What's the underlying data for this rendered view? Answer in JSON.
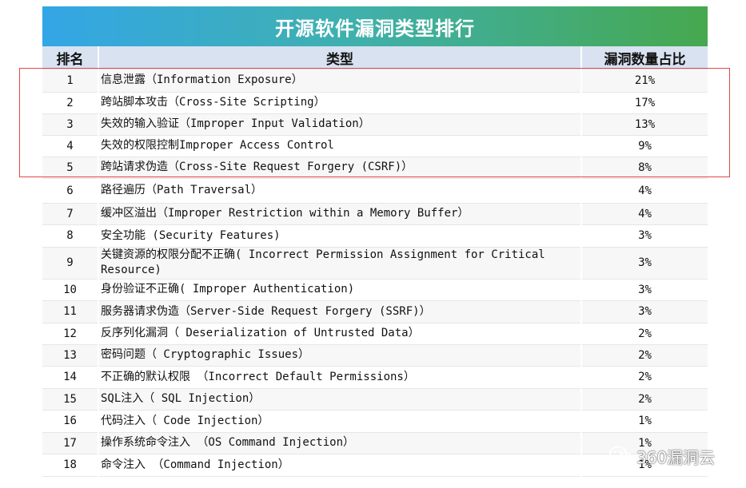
{
  "title": "开源软件漏洞类型排行",
  "headers": {
    "rank": "排名",
    "type": "类型",
    "share": "漏洞数量占比"
  },
  "rows": [
    {
      "rank": "1",
      "type": "信息泄露（Information Exposure）",
      "share": "21%"
    },
    {
      "rank": "2",
      "type": "跨站脚本攻击（Cross-Site Scripting）",
      "share": "17%"
    },
    {
      "rank": "3",
      "type": "失效的输入验证（Improper Input Validation）",
      "share": "13%"
    },
    {
      "rank": "4",
      "type": "失效的权限控制Improper Access Control",
      "share": "9%"
    },
    {
      "rank": "5",
      "type": "跨站请求伪造（Cross-Site Request Forgery (CSRF)）",
      "share": "8%"
    },
    {
      "rank": "6",
      "type": "路径遍历（Path Traversal）",
      "share": "4%"
    },
    {
      "rank": "7",
      "type": "缓冲区溢出（Improper Restriction within a Memory Buffer）",
      "share": "4%"
    },
    {
      "rank": "8",
      "type": "安全功能 (Security Features)",
      "share": "3%"
    },
    {
      "rank": "9",
      "type": "关键资源的权限分配不正确( Incorrect Permission Assignment for Critical Resource)",
      "share": "3%"
    },
    {
      "rank": "10",
      "type": "身份验证不正确( Improper Authentication)",
      "share": "3%"
    },
    {
      "rank": "11",
      "type": "服务器请求伪造（Server-Side Request Forgery (SSRF)）",
      "share": "3%"
    },
    {
      "rank": "12",
      "type": "反序列化漏洞（ Deserialization of Untrusted Data）",
      "share": "2%"
    },
    {
      "rank": "13",
      "type": "密码问题（ Cryptographic Issues）",
      "share": "2%"
    },
    {
      "rank": "14",
      "type": "不正确的默认权限 （Incorrect Default Permissions）",
      "share": "2%"
    },
    {
      "rank": "15",
      "type": "SQL注入（ SQL Injection）",
      "share": "2%"
    },
    {
      "rank": "16",
      "type": "代码注入（ Code Injection）",
      "share": "1%"
    },
    {
      "rank": "17",
      "type": "操作系统命令注入 （OS Command Injection）",
      "share": "1%"
    },
    {
      "rank": "18",
      "type": "命令注入 （Command Injection）",
      "share": "1%"
    }
  ],
  "watermark": {
    "text": "360漏洞云",
    "icon": "wechat-icon"
  },
  "colors": {
    "title_start": "#33a6e6",
    "title_end": "#46a84e",
    "header_bg": "#d9e2f1",
    "highlight": "#e2474b"
  }
}
